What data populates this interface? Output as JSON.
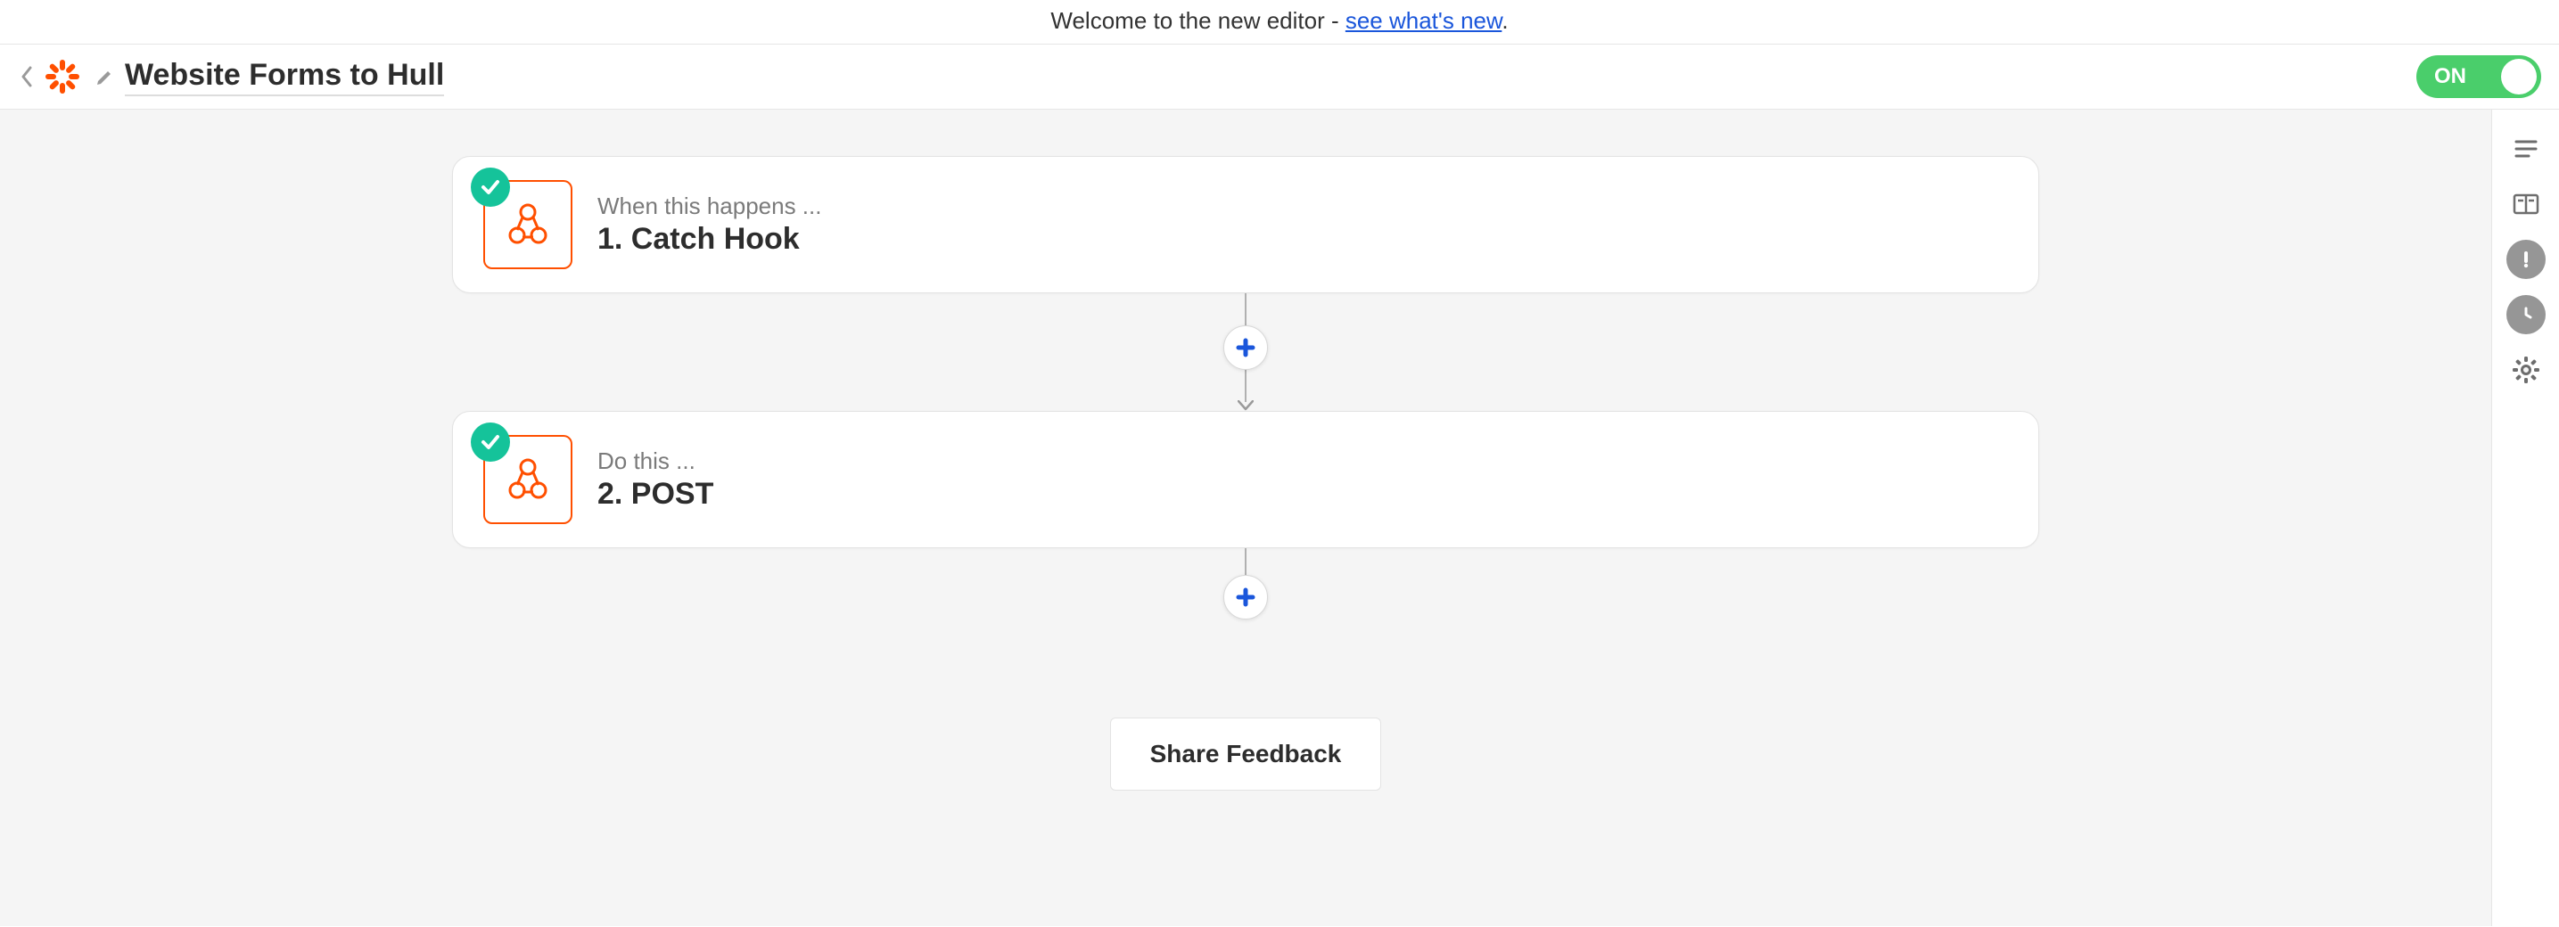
{
  "banner": {
    "prefix": "Welcome to the new editor - ",
    "link_text": "see what's new",
    "suffix": "."
  },
  "header": {
    "title": "Website Forms to Hull",
    "toggle_label": "ON",
    "toggle_state": true
  },
  "steps": [
    {
      "subtitle": "When this happens ...",
      "title": "1. Catch Hook",
      "status": "success"
    },
    {
      "subtitle": "Do this ...",
      "title": "2. POST",
      "status": "success"
    }
  ],
  "feedback_button": "Share Feedback",
  "rail": {
    "outline": "outline-icon",
    "guide": "guide-icon",
    "alerts": "alerts-icon",
    "history": "history-icon",
    "settings": "settings-icon"
  }
}
